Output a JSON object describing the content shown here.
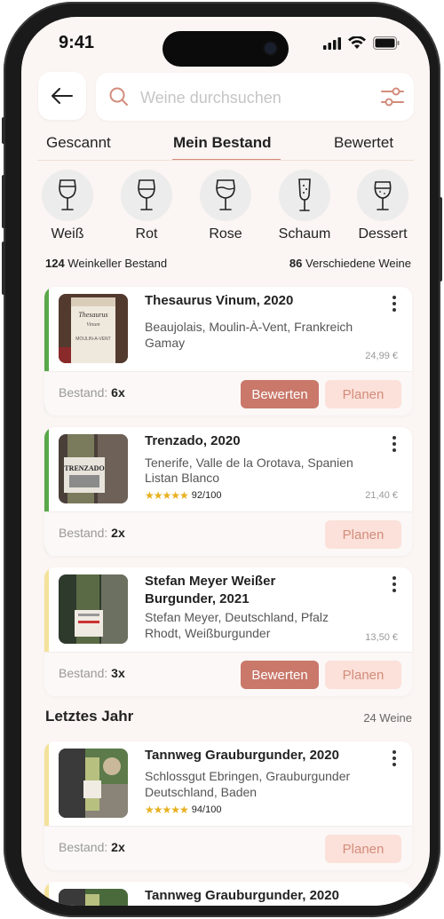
{
  "status": {
    "time": "9:41"
  },
  "search": {
    "placeholder": "Weine durchsuchen"
  },
  "tabs": [
    {
      "label": "Gescannt"
    },
    {
      "label": "Mein Bestand"
    },
    {
      "label": "Bewertet"
    }
  ],
  "categories": [
    {
      "label": "Weiß",
      "icon": "white-wine-glass-icon"
    },
    {
      "label": "Rot",
      "icon": "red-wine-glass-icon"
    },
    {
      "label": "Rose",
      "icon": "rose-wine-glass-icon"
    },
    {
      "label": "Schaum",
      "icon": "sparkling-wine-glass-icon"
    },
    {
      "label": "Dessert",
      "icon": "dessert-wine-glass-icon"
    }
  ],
  "stats": {
    "cellar_count": "124",
    "cellar_label": "Weinkeller Bestand",
    "distinct_count": "86",
    "distinct_label": "Verschiedene Weine"
  },
  "colors": {
    "accent": "#c9786a",
    "accent_light": "#fbe1d9",
    "green": "#5aa84a",
    "yellow": "#f4e29a",
    "star": "#e8b01f"
  },
  "wines": [
    {
      "title": "Thesaurus Vinum, 2020",
      "line1": "Beaujolais, Moulin-À-Vent, Frankreich",
      "line2": "Gamay",
      "price": "24,99 €",
      "stock_label": "Bestand:",
      "stock": "6x",
      "rate_label": "Bewerten",
      "plan_label": "Planen"
    },
    {
      "title": "Trenzado, 2020",
      "line1": "Tenerife, Valle de la Orotava, Spanien",
      "line2": "Listan Blanco",
      "stars": "★★★★★",
      "rating": "92/100",
      "price": "21,40 €",
      "stock_label": "Bestand:",
      "stock": "2x",
      "plan_label": "Planen"
    },
    {
      "title_line1": "Stefan Meyer Weißer",
      "title_line2": "Burgunder, 2021",
      "line1": "Stefan Meyer, Deutschland, Pfalz",
      "line2": "Rhodt, Weißburgunder",
      "price": "13,50 €",
      "stock_label": "Bestand:",
      "stock": "3x",
      "rate_label": "Bewerten",
      "plan_label": "Planen"
    }
  ],
  "section": {
    "title": "Letztes Jahr",
    "count": "24 Weine"
  },
  "last_year": [
    {
      "title": "Tannweg Grauburgunder, 2020",
      "line1": "Schlossgut Ebringen, Grauburgunder",
      "line2": "Deutschland, Baden",
      "stars": "★★★★★",
      "rating": "94/100",
      "stock_label": "Bestand:",
      "stock": "2x",
      "plan_label": "Planen"
    },
    {
      "title": "Tannweg Grauburgunder, 2020"
    }
  ]
}
